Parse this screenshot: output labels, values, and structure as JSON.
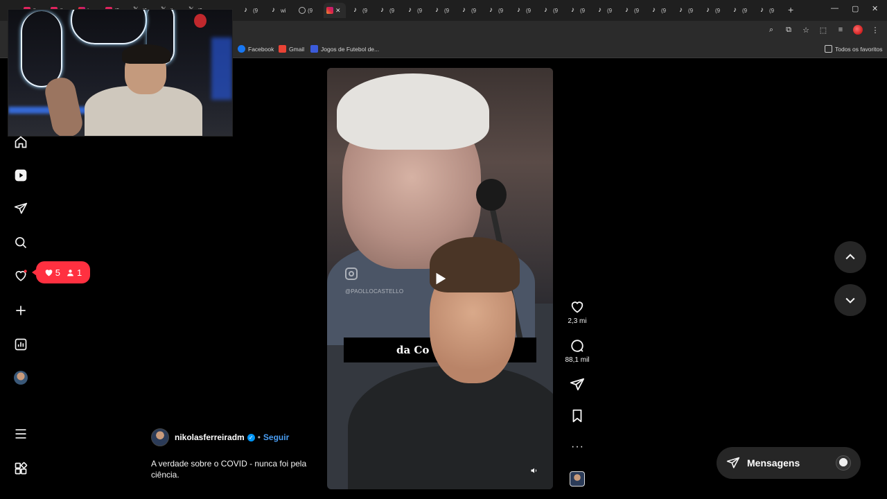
{
  "browser": {
    "active_tab_close": "✕",
    "new_tab": "+",
    "window_controls": [
      "—",
      "▢",
      "✕"
    ],
    "tab_label_snippets": [
      "(l",
      "(l",
      "In",
      "(3",
      "(6",
      "(l",
      "(9",
      "(9",
      "wi",
      "(9",
      "(9"
    ]
  },
  "bookmarks": {
    "items": [
      {
        "label": "Facebook",
        "icon": "facebook-icon"
      },
      {
        "label": "Gmail",
        "icon": "gmail-icon"
      },
      {
        "label": "Jogos de Futebol de...",
        "icon": "jogos-icon"
      }
    ],
    "all_bookmarks": "Todos os favoritos"
  },
  "nav": {
    "items": [
      "home",
      "reels",
      "explore",
      "search",
      "notifications",
      "create",
      "dashboard",
      "profile",
      "more",
      "threads"
    ],
    "notifications_pill": {
      "likes": "5",
      "followers": "1",
      "color": "#ff3040"
    }
  },
  "reel": {
    "watermark": "@PAOLLOCASTELLO",
    "caption_overlay": "da Co"
  },
  "actions": {
    "likes": "2,3 mi",
    "comments": "88,1 mil"
  },
  "post": {
    "username": "nikolasferreiradm",
    "separator": "•",
    "follow": "Seguir",
    "caption": "A verdade sobre o COVID - nunca foi pela ciência."
  },
  "messages": {
    "label": "Mensagens"
  },
  "colors": {
    "accent_blue": "#0095f6",
    "follow_link": "#4a9ef4",
    "background": "#000000",
    "chrome": "#2b2b2b"
  }
}
